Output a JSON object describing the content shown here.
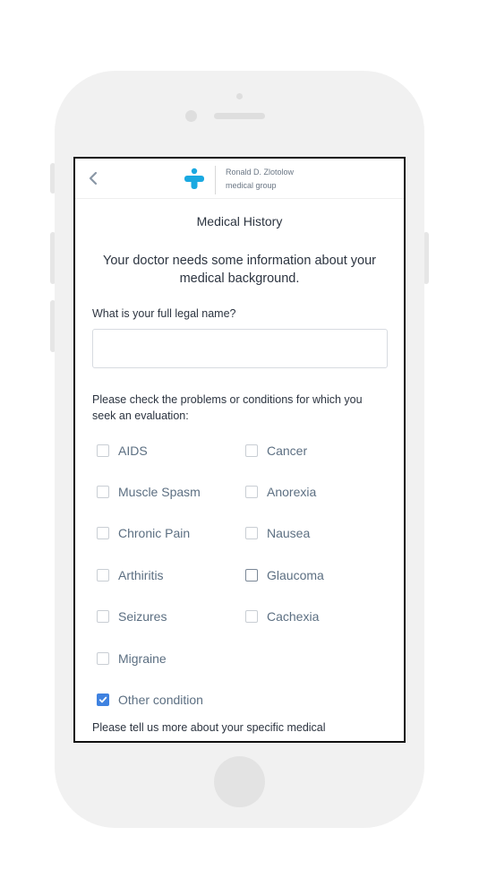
{
  "header": {
    "brand_name": "Ronald D. Zlotolow",
    "brand_sub": "medical group"
  },
  "page": {
    "title": "Medical History",
    "intro": "Your doctor needs some information about your medical background."
  },
  "form": {
    "name_question": "What is your full legal name?",
    "name_value": "",
    "conditions_question": "Please check the problems or conditions for which you seek an evaluation:",
    "conditions": {
      "aids": {
        "label": "AIDS",
        "checked": false
      },
      "cancer": {
        "label": "Cancer",
        "checked": false
      },
      "muscle_spasm": {
        "label": "Muscle Spasm",
        "checked": false
      },
      "anorexia": {
        "label": "Anorexia",
        "checked": false
      },
      "chronic_pain": {
        "label": "Chronic Pain",
        "checked": false
      },
      "nausea": {
        "label": "Nausea",
        "checked": false
      },
      "arthiritis": {
        "label": "Arthiritis",
        "checked": false
      },
      "glaucoma": {
        "label": "Glaucoma",
        "checked": false
      },
      "seizures": {
        "label": "Seizures",
        "checked": false
      },
      "cachexia": {
        "label": "Cachexia",
        "checked": false
      },
      "migraine": {
        "label": "Migraine",
        "checked": false
      },
      "other": {
        "label": "Other condition",
        "checked": true
      }
    },
    "more_prompt": "Please tell us more about your specific medical"
  },
  "colors": {
    "accent": "#3f82e0",
    "logo": "#1aa9e1",
    "label": "#5c6f82"
  }
}
